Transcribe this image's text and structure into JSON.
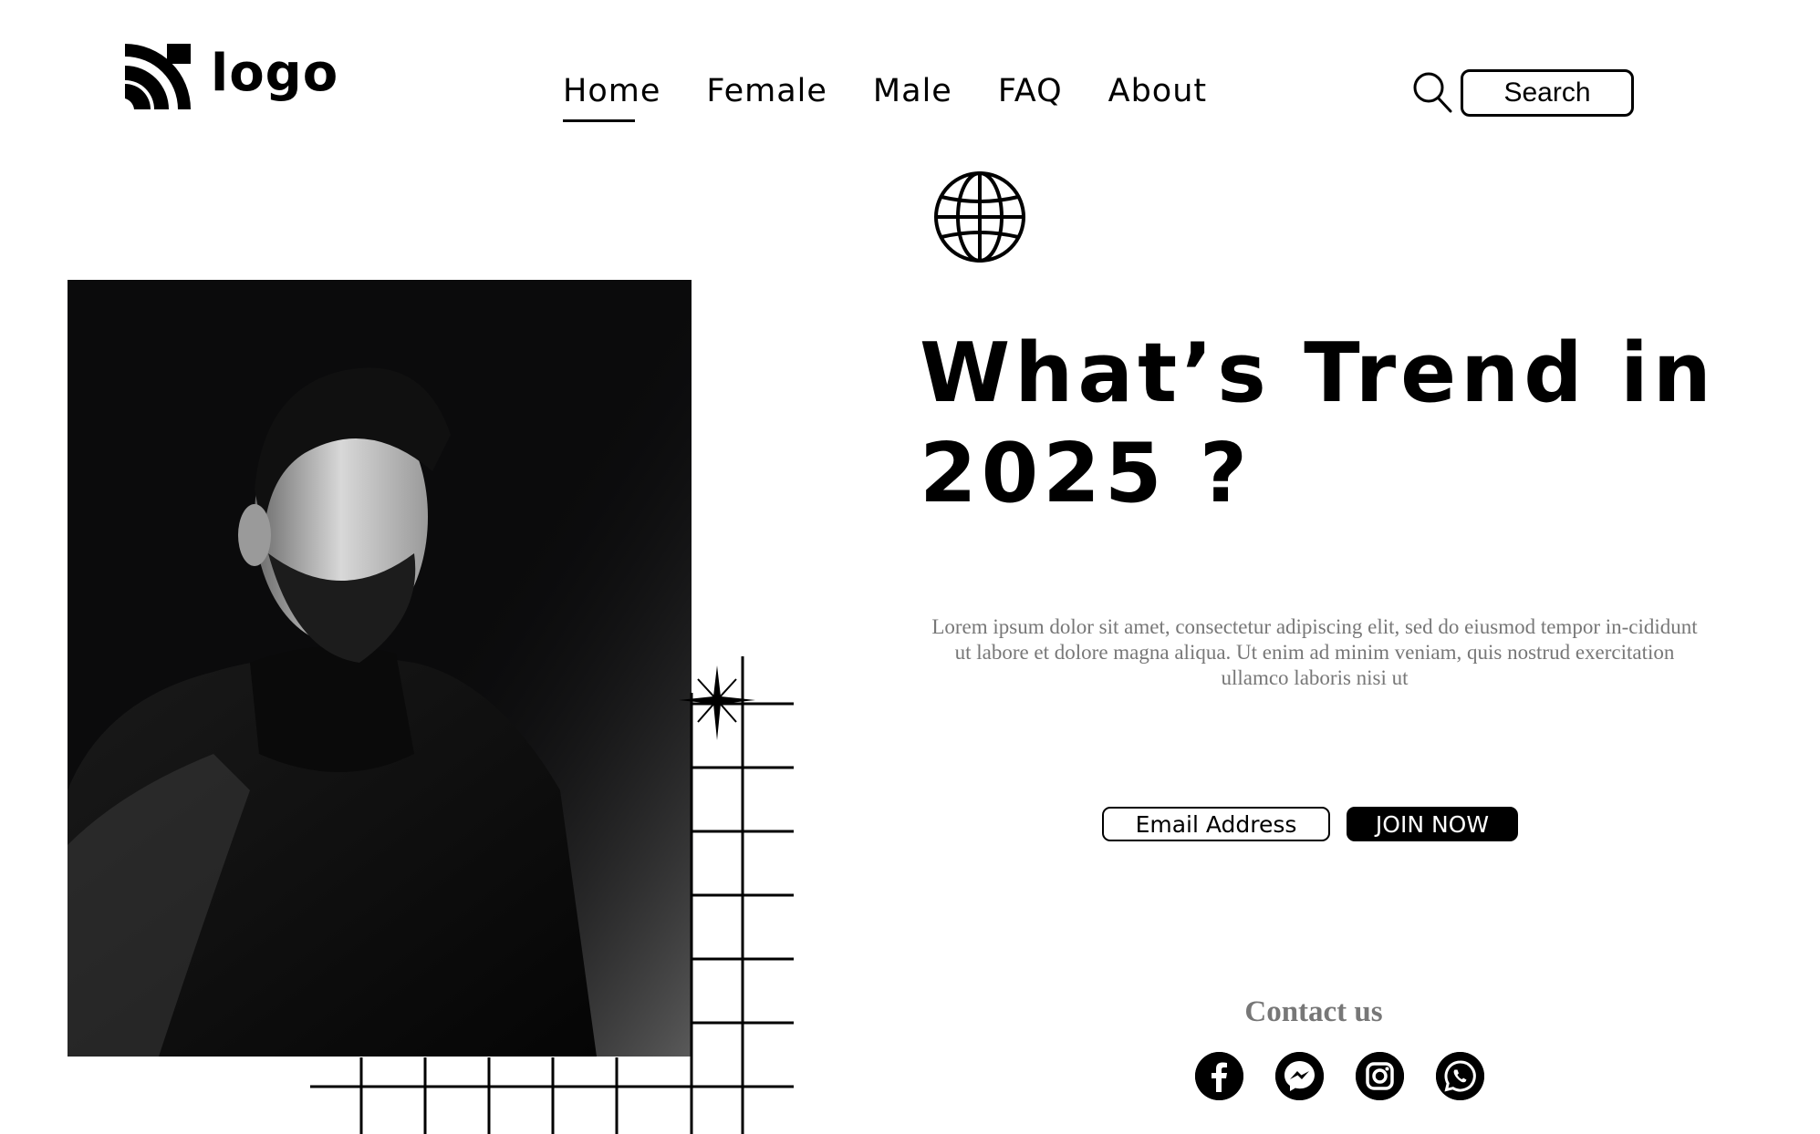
{
  "header": {
    "logo_text": "logo",
    "nav": [
      {
        "label": "Home",
        "active": true
      },
      {
        "label": "Female",
        "active": false
      },
      {
        "label": "Male",
        "active": false
      },
      {
        "label": "FAQ",
        "active": false
      },
      {
        "label": "About",
        "active": false
      }
    ],
    "search_label": "Search"
  },
  "hero": {
    "headline_line1": "What’s Trend in",
    "headline_line2": "2025 ?",
    "body": "Lorem ipsum dolor sit amet, consectetur adipiscing elit, sed do eiusmod tempor in-cididunt ut labore et dolore magna aliqua. Ut enim ad minim veniam, quis nostrud exercitation ullamco laboris nisi ut",
    "email_placeholder": "Email Address",
    "join_label": "JOIN NOW"
  },
  "contact": {
    "title": "Contact us",
    "socials": [
      "facebook-icon",
      "messenger-icon",
      "instagram-icon",
      "whatsapp-icon"
    ]
  },
  "colors": {
    "text": "#000000",
    "muted": "#777777",
    "background": "#ffffff"
  }
}
